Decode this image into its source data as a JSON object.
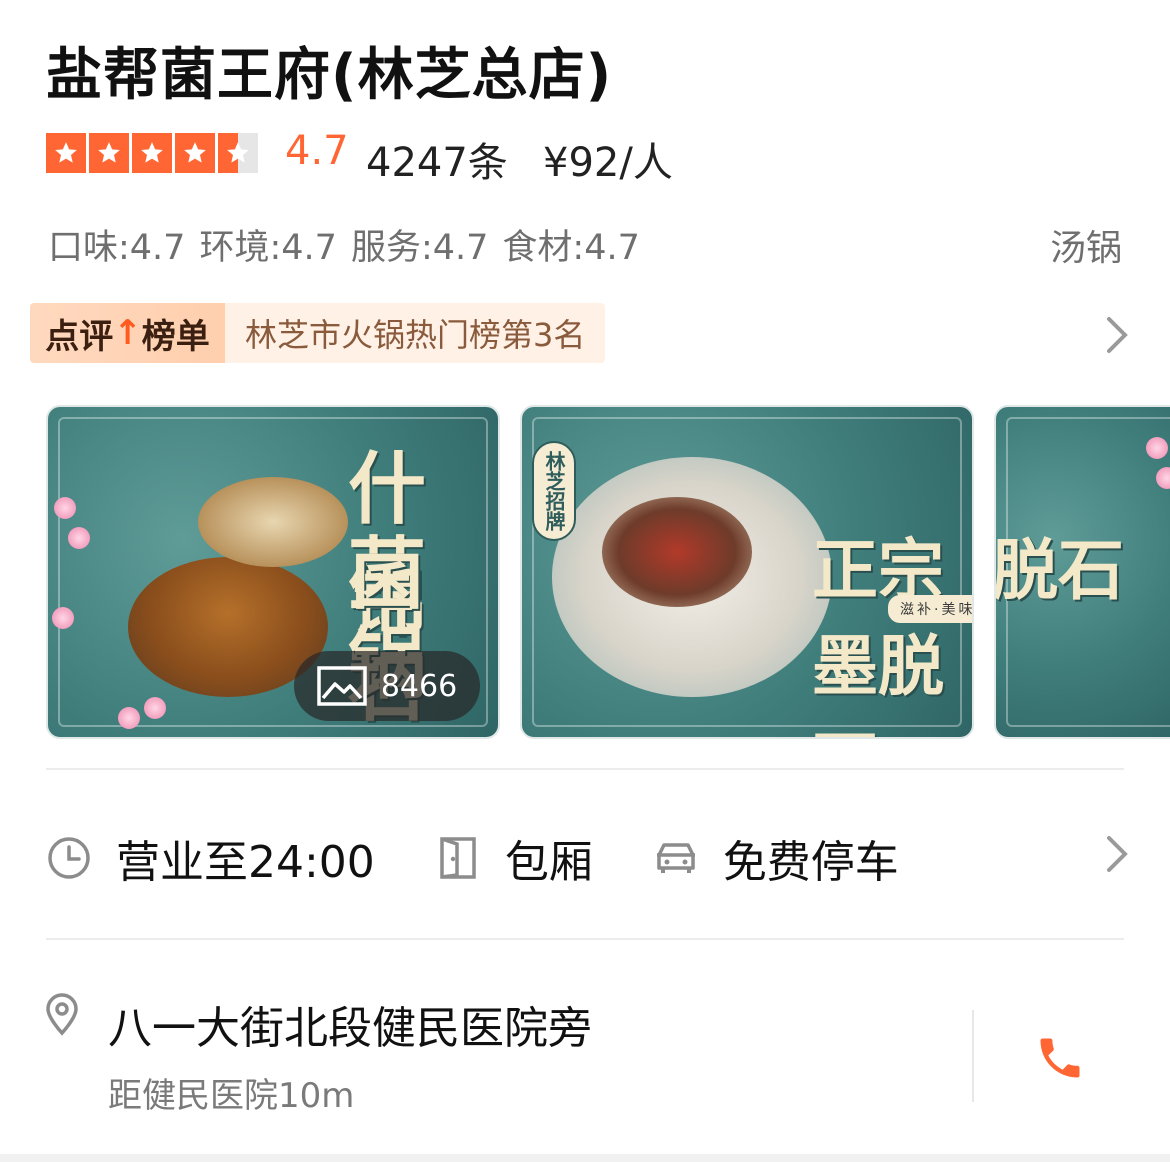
{
  "shop": {
    "name": "盐帮菌王府(林芝总店)",
    "rating_stars": 4.5,
    "score": "4.7",
    "review_count": "4247条",
    "price": "¥92/人",
    "sub_scores": [
      "口味:4.7",
      "环境:4.7",
      "服务:4.7",
      "食材:4.7"
    ],
    "category": "汤锅"
  },
  "rank": {
    "tag_part1": "点评",
    "tag_part2": "榜单",
    "text": "林芝市火锅热门榜第3名"
  },
  "photos": {
    "count": "8466",
    "items": [
      {
        "calligraphy": [
          "什锦",
          "菌石",
          "锅"
        ]
      },
      {
        "badge": "林芝招牌",
        "calligraphy": "正宗墨脱石",
        "ribbon": "滋补·美味·药膳·养生"
      },
      {
        "calligraphy": "脱石"
      }
    ]
  },
  "features": {
    "hours": "营业至24:00",
    "room": "包厢",
    "parking": "免费停车"
  },
  "address": {
    "line": "八一大街北段健民医院旁",
    "distance": "距健民医院10m"
  },
  "colors": {
    "accent": "#ff6633",
    "rank_bg": "#fff1e6",
    "photo_teal": "#3f7d7b"
  },
  "icons": [
    "star-icon",
    "chevron-right-icon",
    "image-icon",
    "clock-icon",
    "door-icon",
    "car-icon",
    "location-pin-icon",
    "phone-icon"
  ]
}
